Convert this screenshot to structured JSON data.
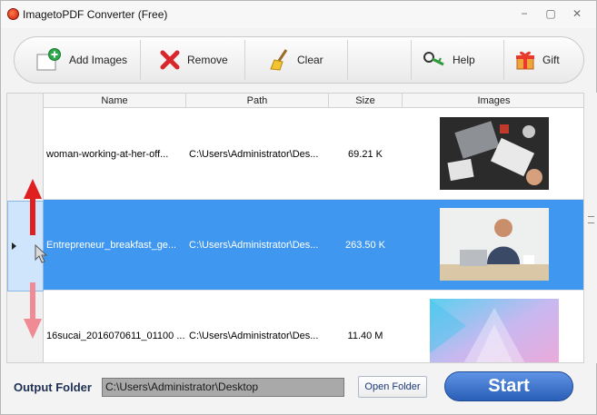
{
  "window": {
    "title": "ImagetoPDF Converter (Free)",
    "controls": {
      "minimize": "−",
      "restore": "▢",
      "close": "✕"
    }
  },
  "toolbar": {
    "add_images": "Add Images",
    "remove": "Remove",
    "clear": "Clear",
    "help": "Help",
    "gift": "Gift"
  },
  "grid": {
    "columns": [
      "Name",
      "Path",
      "Size",
      "Images"
    ],
    "rows": [
      {
        "name": "woman-working-at-her-off...",
        "path": "C:\\Users\\Administrator\\Des...",
        "size": "69.21 K",
        "thumb": "desk-photo",
        "selected": false
      },
      {
        "name": "Entrepreneur_breakfast_ge...",
        "path": "C:\\Users\\Administrator\\Des...",
        "size": "263.50 K",
        "thumb": "man-at-laptop-photo",
        "selected": true
      },
      {
        "name": "16sucai_2016070611_01100 ...",
        "path": "C:\\Users\\Administrator\\Des...",
        "size": "11.40 M",
        "thumb": "pastel-polygon-photo",
        "selected": false
      }
    ]
  },
  "output": {
    "label": "Output Folder",
    "path": "C:\\Users\\Administrator\\Desktop",
    "open_folder": "Open Folder",
    "start": "Start"
  },
  "colors": {
    "selection": "#3f97f0",
    "start_button": "#3a72cf",
    "arrow_up": "#e02020",
    "arrow_down": "#f08a94"
  }
}
